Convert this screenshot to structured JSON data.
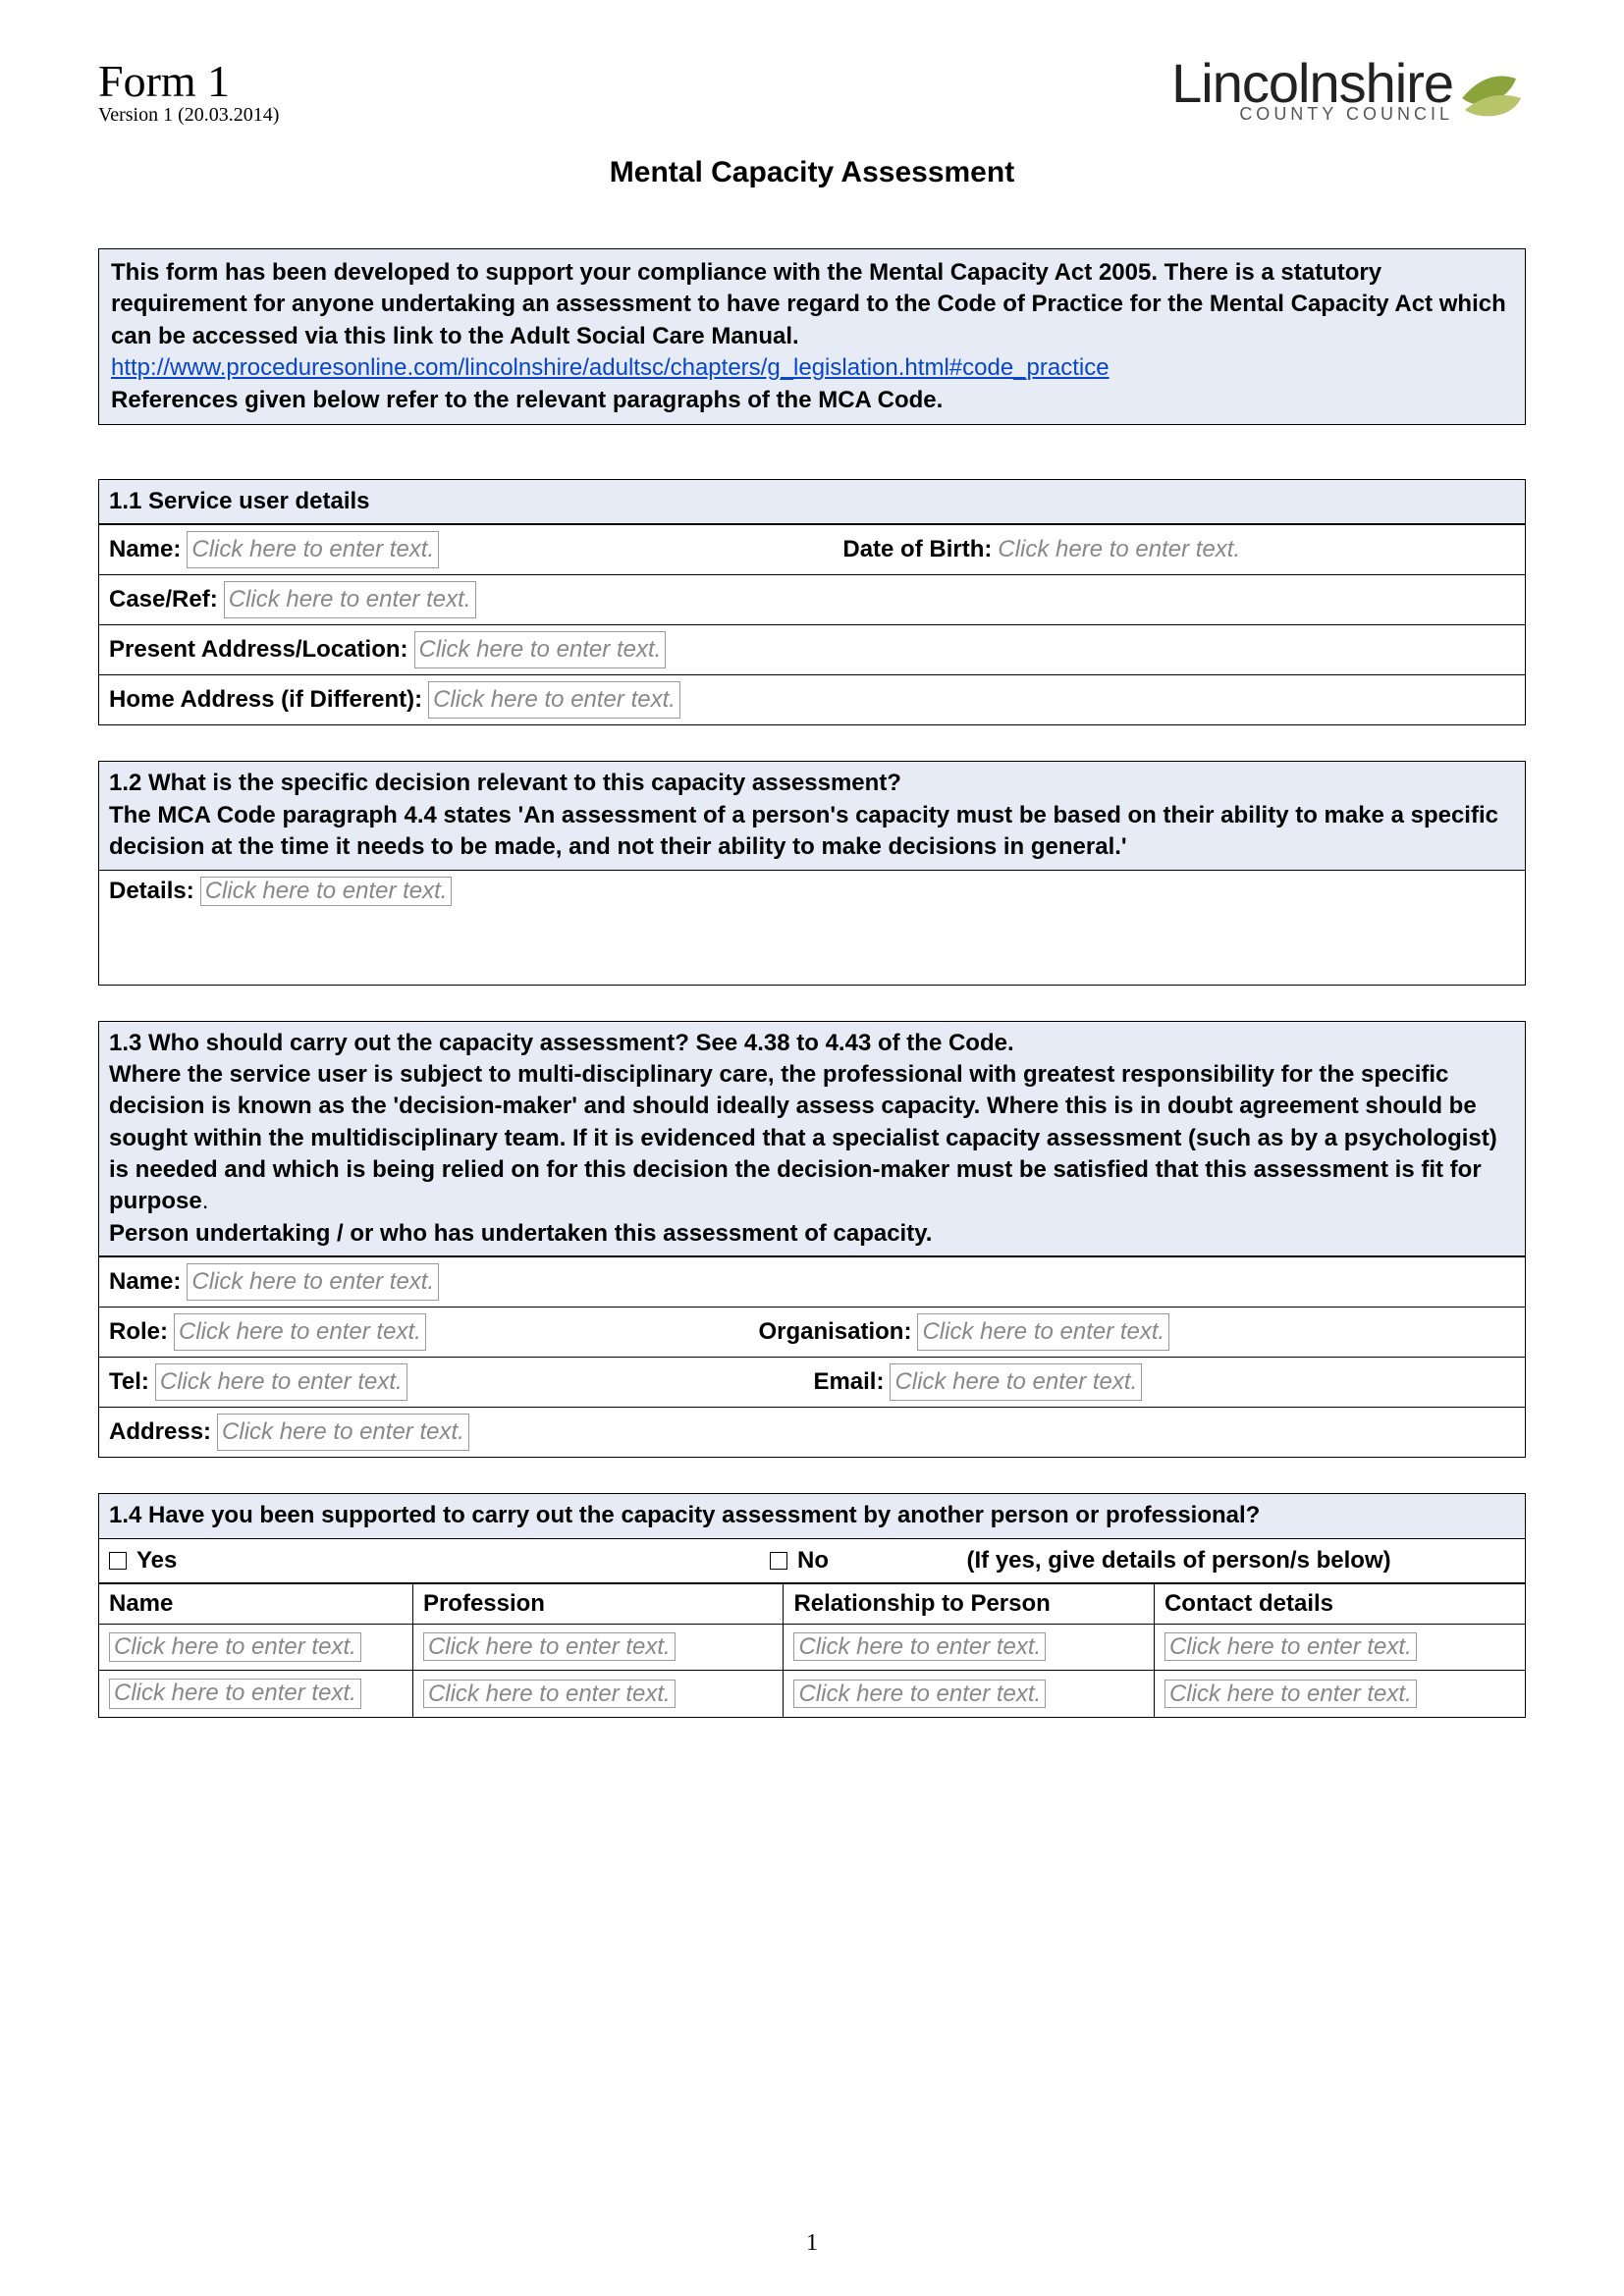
{
  "header": {
    "form_number": "Form 1",
    "version": "Version 1 (20.03.2014)",
    "logo_text": "Lincolnshire",
    "logo_sub": "COUNTY COUNCIL"
  },
  "title": "Mental Capacity Assessment",
  "intro": {
    "line1": "This form has been developed to support your compliance with the Mental Capacity Act 2005. There is a statutory requirement for anyone undertaking an assessment to have regard to the Code of Practice for the Mental Capacity Act which can be accessed via this link to the Adult Social Care Manual.",
    "link": "http://www.proceduresonline.com/lincolnshire/adultsc/chapters/g_legislation.html#code_practice",
    "line2": "References given below refer to the relevant paragraphs of the MCA Code."
  },
  "placeholder": "Click here to enter text.",
  "s11": {
    "heading": "1.1 Service user details",
    "name_label": "Name:",
    "dob_label": "Date of Birth:",
    "caseref_label": "Case/Ref:",
    "present_addr_label": "Present Address/Location:",
    "home_addr_label": "Home Address (if Different):"
  },
  "s12": {
    "heading_line1": "1.2 What is the specific decision relevant to this capacity assessment?",
    "heading_line2": "The MCA Code paragraph 4.4 states 'An assessment of a person's capacity must be based on their ability to make a specific decision at the time it needs to be made, and not their ability to make decisions in general.'",
    "details_label": "Details:"
  },
  "s13": {
    "heading_line1": "1.3 Who should carry out the capacity assessment? See 4.38 to 4.43 of the Code.",
    "heading_line2": "Where the service user is subject to multi-disciplinary care, the professional with greatest responsibility for the specific decision is known as the 'decision-maker' and should ideally assess capacity. Where this is in doubt agreement should be sought within the multidisciplinary team. If it is evidenced that a specialist capacity assessment (such as by a psychologist) is needed and which is being relied on for this decision the decision-maker must be satisfied that this assessment is fit for purpose",
    "heading_line3": "Person undertaking / or who has undertaken this assessment of capacity.",
    "name_label": "Name:",
    "role_label": "Role:",
    "org_label": "Organisation:",
    "tel_label": "Tel:",
    "email_label": "Email:",
    "address_label": "Address:"
  },
  "s14": {
    "heading": "1.4 Have you been supported to carry out the capacity assessment by another person or professional?",
    "yes": "Yes",
    "no": "No",
    "hint": "(If yes, give details of person/s below)",
    "col_name": "Name",
    "col_profession": "Profession",
    "col_relationship": "Relationship to Person",
    "col_contact": "Contact details"
  },
  "page_number": "1"
}
